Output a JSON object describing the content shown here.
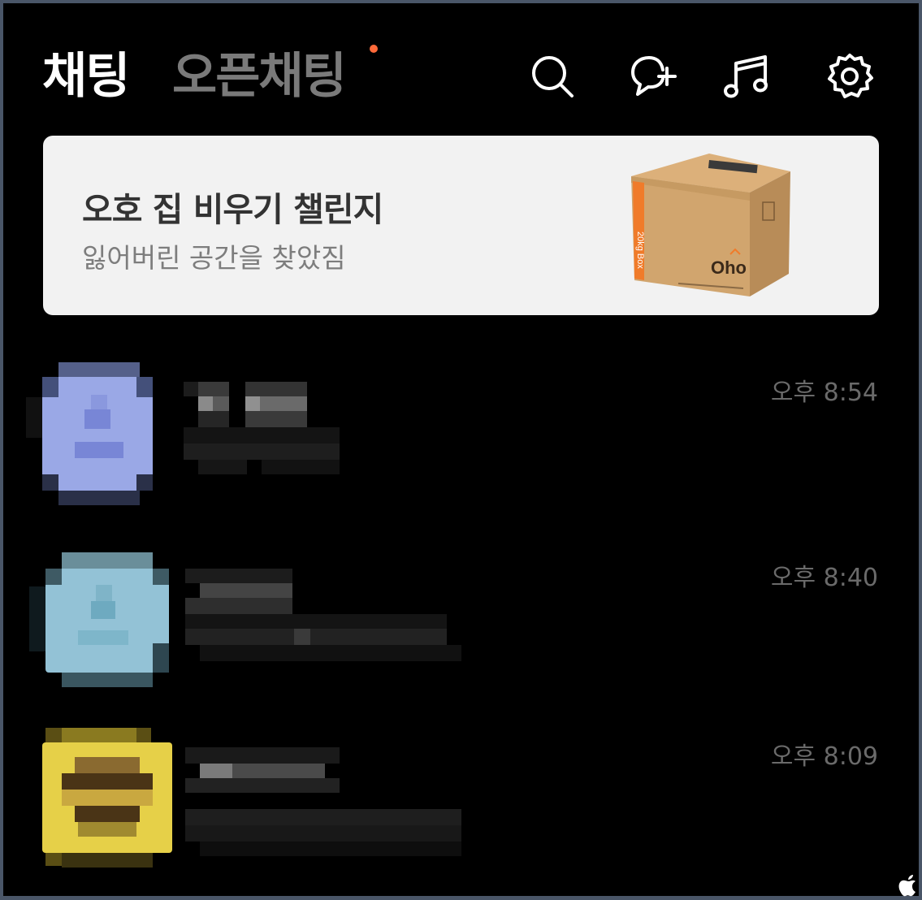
{
  "header": {
    "tab_chat": "채팅",
    "tab_open_chat": "오픈채팅",
    "icons": [
      "search-icon",
      "new-chat-icon",
      "music-icon",
      "settings-icon"
    ]
  },
  "banner": {
    "title": "오호 집 비우기 챌린지",
    "subtitle": "잃어버린 공간을 찾았짐",
    "box_side_text": "20kg Box",
    "box_logo": "Oho"
  },
  "chats": [
    {
      "time": "오후 8:54",
      "avatar_color": "#9aa8e6",
      "name_redacted": true,
      "preview_redacted": true
    },
    {
      "time": "오후 8:40",
      "avatar_color": "#93c2d6",
      "name_redacted": true,
      "preview_redacted": true
    },
    {
      "time": "오후 8:09",
      "avatar_color": "#e6d048",
      "name_redacted": true,
      "preview_redacted": true
    }
  ],
  "colors": {
    "background": "#000000",
    "active_tab": "#ffffff",
    "inactive_tab": "#7a7a7a",
    "notification_dot": "#ff6a3a",
    "banner_bg": "#f2f2f2"
  }
}
